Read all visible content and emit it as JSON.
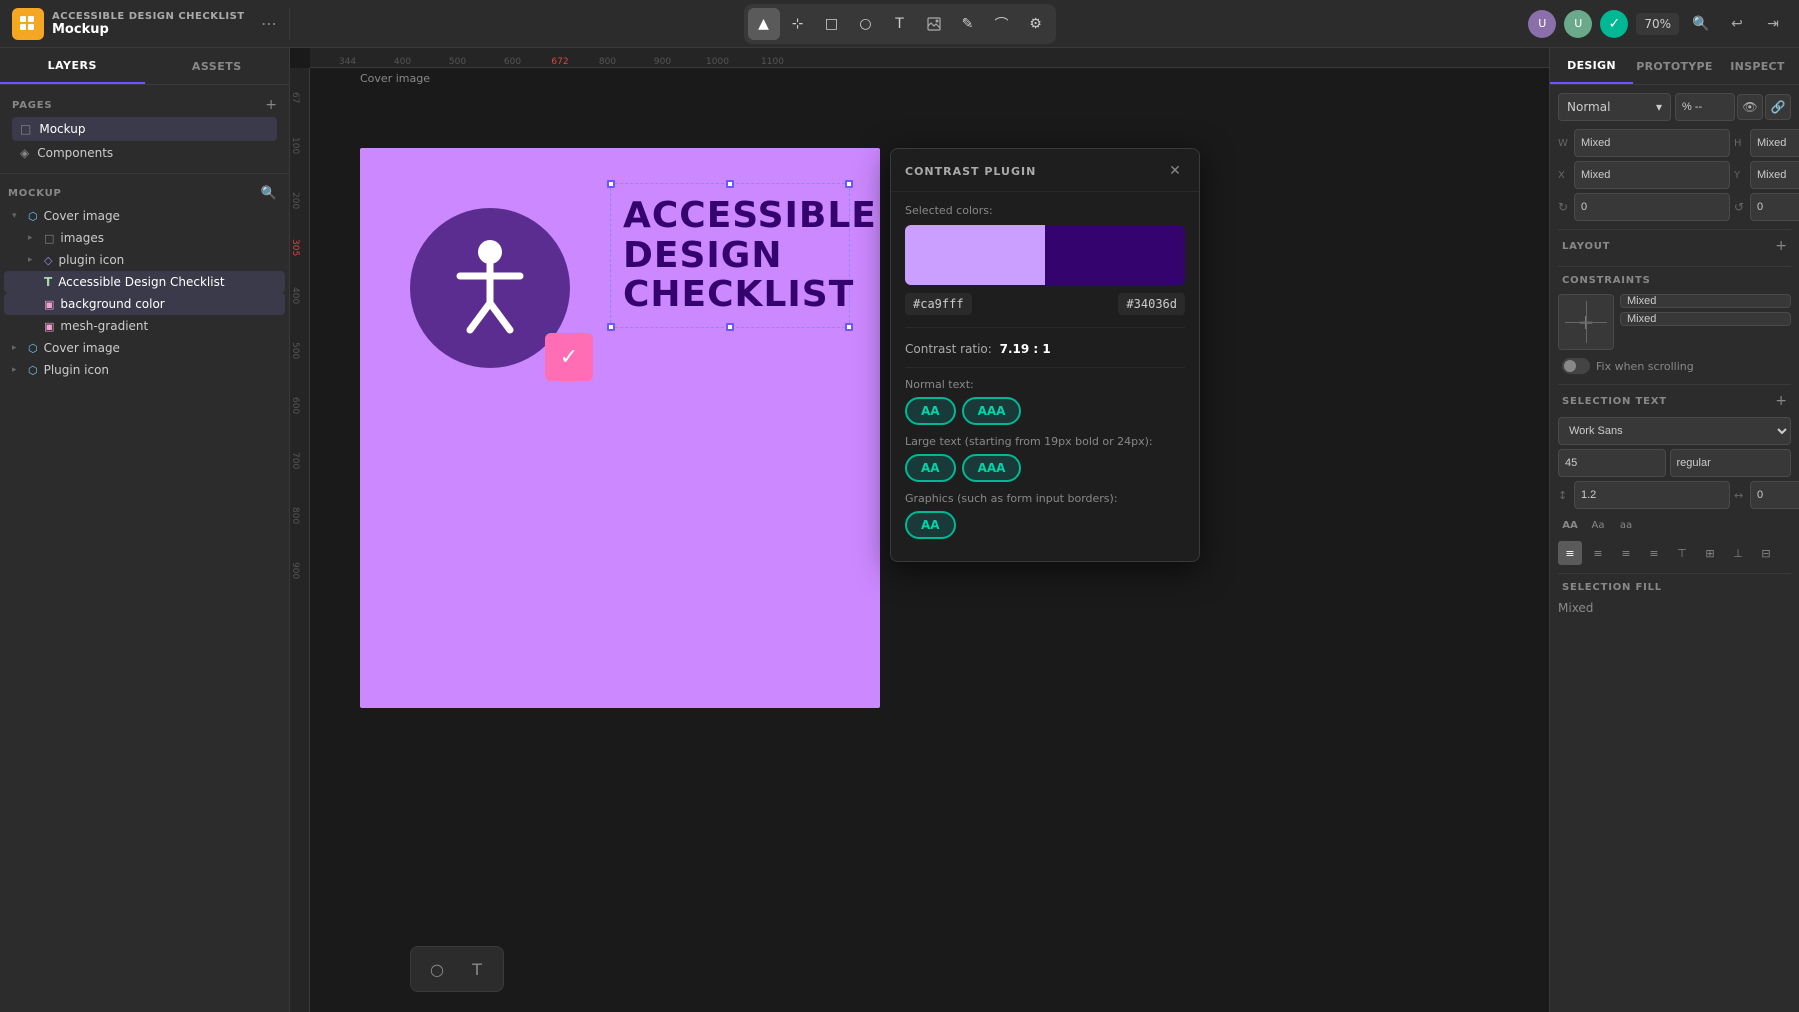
{
  "app": {
    "title": "ACCESSIBLE DESIGN CHECKLIST",
    "subtitle": "Mockup",
    "zoom": "70%"
  },
  "toolbar": {
    "tools": [
      "▲",
      "⊹",
      "□",
      "○",
      "T",
      "⬜",
      "✎",
      "⌒",
      "⚙"
    ]
  },
  "left_panel": {
    "tabs": [
      "LAYERS",
      "ASSETS"
    ],
    "active_tab": "LAYERS",
    "pages_label": "PAGES",
    "pages": [
      {
        "name": "Mockup",
        "icon": "□",
        "active": true
      },
      {
        "name": "Components",
        "icon": "◈"
      }
    ],
    "mockup_label": "MOCKUP",
    "layers": [
      {
        "name": "Cover image",
        "type": "frame",
        "depth": 0,
        "expanded": true
      },
      {
        "name": "images",
        "type": "group",
        "depth": 1,
        "expanded": true
      },
      {
        "name": "plugin icon",
        "type": "component",
        "depth": 1,
        "expanded": false
      },
      {
        "name": "Accessible Design Checklist",
        "type": "text",
        "depth": 1,
        "selected": true
      },
      {
        "name": "background color",
        "type": "rect",
        "depth": 1,
        "selected": true
      },
      {
        "name": "mesh-gradient",
        "type": "rect",
        "depth": 1
      },
      {
        "name": "Cover image",
        "type": "frame",
        "depth": 0
      },
      {
        "name": "Plugin icon",
        "type": "frame",
        "depth": 0
      }
    ]
  },
  "canvas": {
    "label": "Cover image",
    "text": "ACCESSIBLE\nDESIGN\nCHECKLIST",
    "ruler_marks": [
      "344",
      "400",
      "500",
      "600",
      "672",
      "800",
      "900",
      "1000",
      "1100"
    ]
  },
  "contrast_plugin": {
    "title": "CONTRAST PLUGIN",
    "selected_colors_label": "Selected colors:",
    "color1": "#ca9fff",
    "color2": "#34036d",
    "contrast_ratio_label": "Contrast ratio:",
    "contrast_value": "7.19 : 1",
    "normal_text_label": "Normal text:",
    "normal_aa": "AA",
    "normal_aaa": "AAA",
    "large_text_label": "Large text (starting from 19px bold or 24px):",
    "large_aa": "AA",
    "large_aaa": "AAA",
    "graphics_label": "Graphics (such as form input borders):",
    "graphics_aa": "AA"
  },
  "right_panel": {
    "tabs": [
      "DESIGN",
      "PROTOTYPE",
      "INSPECT"
    ],
    "active_tab": "DESIGN",
    "blend_mode": "Normal",
    "opacity": "% --",
    "dimensions": {
      "w_label": "W",
      "w_value": "Mixed",
      "h_label": "H",
      "h_value": "Mixed",
      "x_label": "X",
      "x_value": "Mixed",
      "y_label": "Y",
      "y_value": "Mixed",
      "r1": "0",
      "r2": "0"
    },
    "layout_label": "LAYOUT",
    "constraints_label": "CONSTRAINTS",
    "constraint_h": "Mixed",
    "constraint_v": "Mixed",
    "fix_scroll": "Fix when scrolling",
    "selection_text_label": "SELECTION TEXT",
    "font_family": "Work Sans",
    "font_size": "45",
    "font_weight": "regular",
    "line_height": "1.2",
    "letter_spacing": "0",
    "text_case_buttons": [
      "AA",
      "Aa",
      "aa"
    ],
    "align_buttons": [
      "left",
      "center",
      "right",
      "justify",
      "top",
      "middle",
      "bottom",
      "distribute"
    ],
    "selection_fill_label": "SELECTION FILL",
    "fill_value": "Mixed"
  }
}
